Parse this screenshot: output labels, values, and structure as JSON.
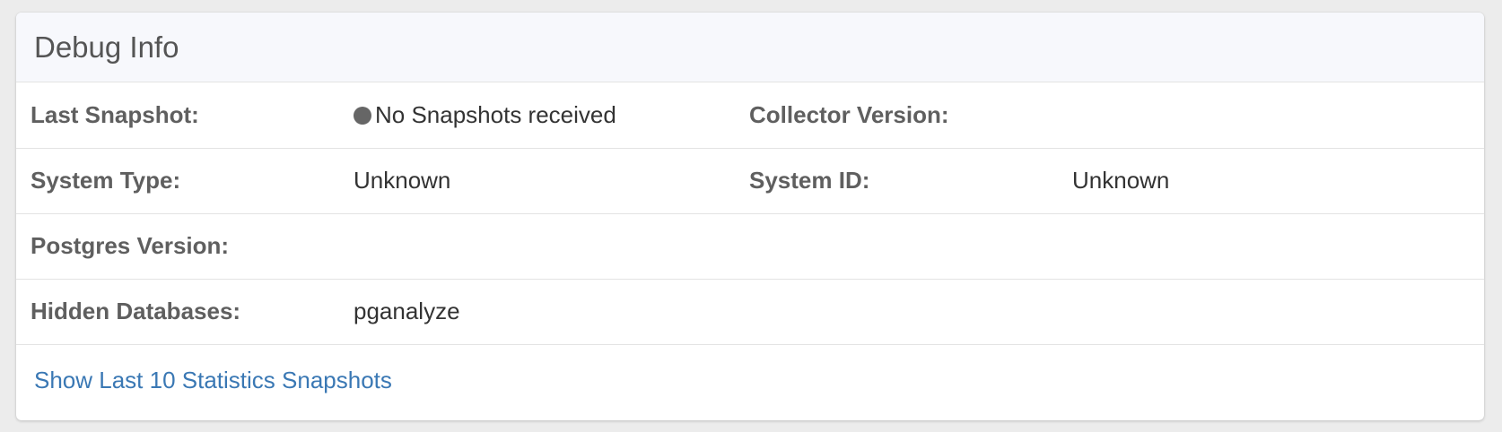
{
  "panel": {
    "title": "Debug Info"
  },
  "rows": [
    {
      "label1": "Last Snapshot:",
      "value1": "No Snapshots received",
      "label2": "Collector Version:",
      "value2": ""
    },
    {
      "label1": "System Type:",
      "value1": "Unknown",
      "label2": "System ID:",
      "value2": "Unknown"
    },
    {
      "label1": "Postgres Version:",
      "value1": "",
      "label2": "",
      "value2": ""
    },
    {
      "label1": "Hidden Databases:",
      "value1": "pganalyze",
      "label2": "",
      "value2": ""
    }
  ],
  "status": {
    "dot_color": "#666666"
  },
  "footer": {
    "link_label": "Show Last 10 Statistics Snapshots",
    "link_color": "#3a78b4"
  },
  "icons": {
    "status": "status-dot-icon"
  }
}
